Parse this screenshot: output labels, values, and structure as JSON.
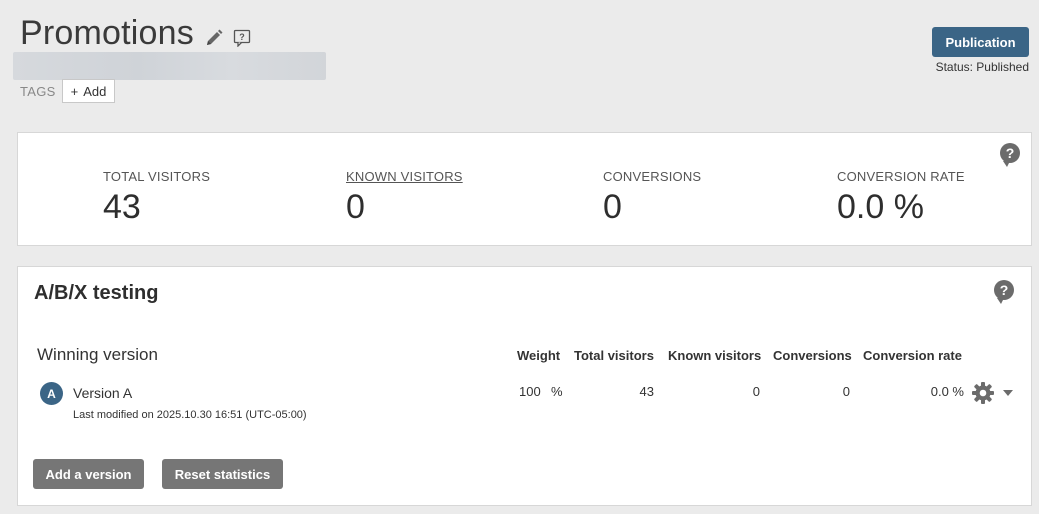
{
  "header": {
    "title": "Promotions",
    "tags_label": "TAGS",
    "add_tag_label": "Add",
    "add_tag_symbol": "+",
    "publish_label": "Publication",
    "status_text": "Status: Published"
  },
  "stats": {
    "help_symbol": "?",
    "items": [
      {
        "label": "TOTAL VISITORS",
        "value": "43"
      },
      {
        "label": "KNOWN VISITORS",
        "value": "0"
      },
      {
        "label": "CONVERSIONS",
        "value": "0"
      },
      {
        "label": "CONVERSION RATE",
        "value": "0.0 %"
      }
    ]
  },
  "ab_testing": {
    "title": "A/B/X testing",
    "help_symbol": "?",
    "winning_label": "Winning version",
    "columns": [
      "Weight",
      "Total visitors",
      "Known visitors",
      "Conversions",
      "Conversion rate"
    ],
    "versions": [
      {
        "badge": "A",
        "name": "Version A",
        "modified": "Last modified on 2025.10.30 16:51 (UTC-05:00)",
        "weight": "100",
        "weight_unit": "%",
        "total_visitors": "43",
        "known_visitors": "0",
        "conversions": "0",
        "conversion_rate": "0.0 %"
      }
    ],
    "add_version_label": "Add a version",
    "reset_label": "Reset statistics"
  },
  "colors": {
    "primary": "#3b6586",
    "gray_button": "#767676",
    "background": "#ebebeb"
  },
  "icons": [
    "pencil-icon",
    "note-icon",
    "help-icon",
    "gear-icon",
    "chevron-down-icon"
  ]
}
